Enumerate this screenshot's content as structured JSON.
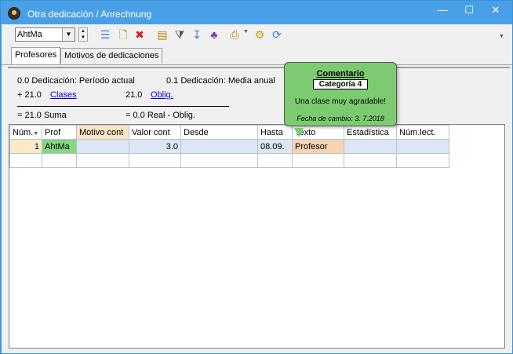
{
  "window": {
    "title": "Otra dedicación / Anrechnung",
    "minimize_glyph": "—",
    "maximize_glyph": "☐",
    "close_glyph": "✕"
  },
  "toolbar": {
    "teacher_select_value": "AhtMa",
    "icons": [
      "list-icon",
      "new-icon",
      "delete-icon",
      "report-icon",
      "filter-icon",
      "sort-icon",
      "users-icon",
      "print-icon",
      "settings-icon",
      "refresh-icon"
    ]
  },
  "tabs": [
    {
      "label": "Profesores",
      "active": true
    },
    {
      "label": "Motivos de dedicaciones",
      "active": false
    }
  ],
  "summary": {
    "current_period": "0.0 Dedicación: Período actual",
    "annual_avg": "0.1  Dedicación: Media anual",
    "classes_value": "+ 21.0",
    "classes_link": "Clases",
    "oblig_value": "21.0",
    "oblig_link": "Oblig.",
    "sum_text": "= 21.0 Suma",
    "real_text": "= 0.0 Real - Oblig."
  },
  "grid": {
    "columns": [
      "Núm.",
      "Prof",
      "Motivo cont",
      "Valor cont",
      "Desde",
      "Hasta",
      "Texto",
      "Estadística",
      "Núm.lect."
    ],
    "rows": [
      {
        "num": "1",
        "prof": "AhtMa",
        "motivo": "",
        "valor": "3.0",
        "desde": "",
        "hasta": "08.09.",
        "texto": "Profesor",
        "estadistica": "",
        "numlect": ""
      }
    ]
  },
  "tooltip": {
    "title": "Comentario",
    "category": "Categoría 4",
    "body": "Una clase muy agradable!",
    "date": "Fecha de cambio: 3. 7.2018"
  },
  "colors": {
    "titlebar": "#4aa0e6",
    "tooltip_bg": "#7ccb71",
    "prof_cell": "#84d67f",
    "text_cell": "#f6d3b1"
  }
}
